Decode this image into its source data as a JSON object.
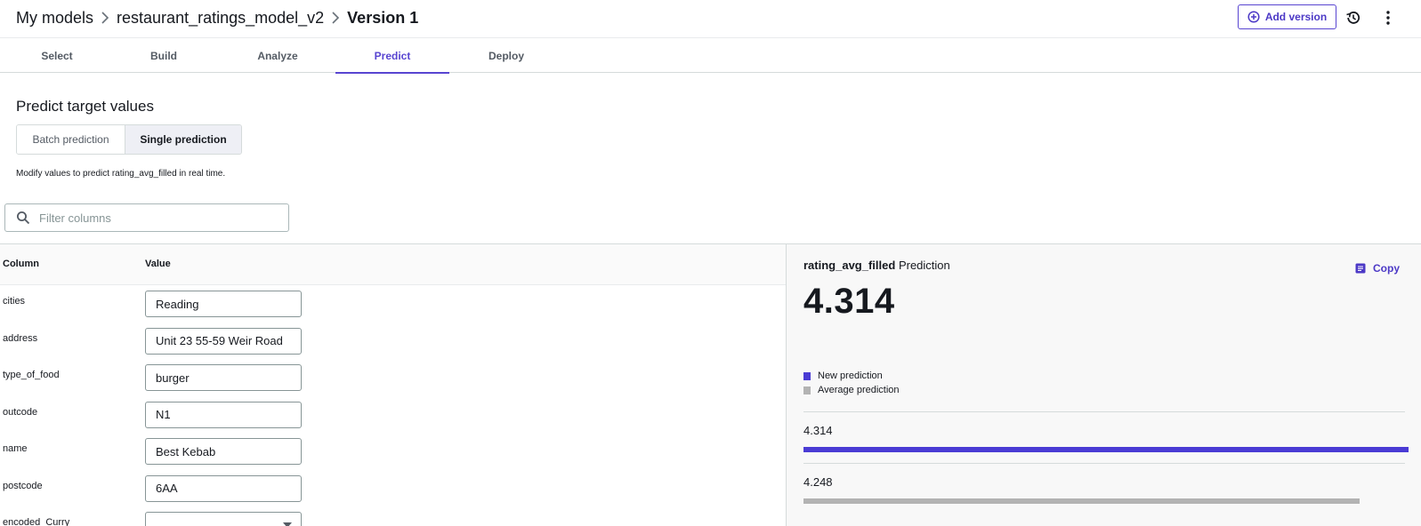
{
  "breadcrumb": {
    "root": "My models",
    "model": "restaurant_ratings_model_v2",
    "version": "Version 1"
  },
  "header": {
    "add_version_label": "Add version",
    "icons": [
      "plus-circle-icon",
      "history-icon",
      "more-vertical-icon"
    ]
  },
  "tabs": [
    {
      "label": "Select",
      "active": false
    },
    {
      "label": "Build",
      "active": false
    },
    {
      "label": "Analyze",
      "active": false
    },
    {
      "label": "Predict",
      "active": true
    },
    {
      "label": "Deploy",
      "active": false
    }
  ],
  "predict": {
    "title": "Predict target values",
    "modes": {
      "batch": "Batch prediction",
      "single": "Single prediction",
      "selected": "Single prediction"
    },
    "hint": "Modify values to predict rating_avg_filled in real time.",
    "filter_placeholder": "Filter columns"
  },
  "table": {
    "headers": {
      "column": "Column",
      "value": "Value"
    },
    "rows": [
      {
        "column": "cities",
        "value": "Reading"
      },
      {
        "column": "address",
        "value": "Unit 23 55-59 Weir Road"
      },
      {
        "column": "type_of_food",
        "value": "burger"
      },
      {
        "column": "outcode",
        "value": "N1"
      },
      {
        "column": "name",
        "value": "Best Kebab"
      },
      {
        "column": "postcode",
        "value": "6AA"
      },
      {
        "column": "encoded_Curry",
        "value": ""
      }
    ]
  },
  "prediction": {
    "target": "rating_avg_filled",
    "suffix": "Prediction",
    "copy_label": "Copy",
    "value": "4.314",
    "legend": {
      "new": "New prediction",
      "average": "Average prediction"
    },
    "bars": [
      {
        "label": "4.314",
        "value": 4.314,
        "color": "#4a3bd4"
      },
      {
        "label": "4.248",
        "value": 4.248,
        "color": "#b3b3b3"
      }
    ],
    "bar_scale_max": 4.314
  },
  "colors": {
    "accent": "#5845d1",
    "new_prediction": "#4a3bd4",
    "average_prediction": "#b3b3b3"
  }
}
